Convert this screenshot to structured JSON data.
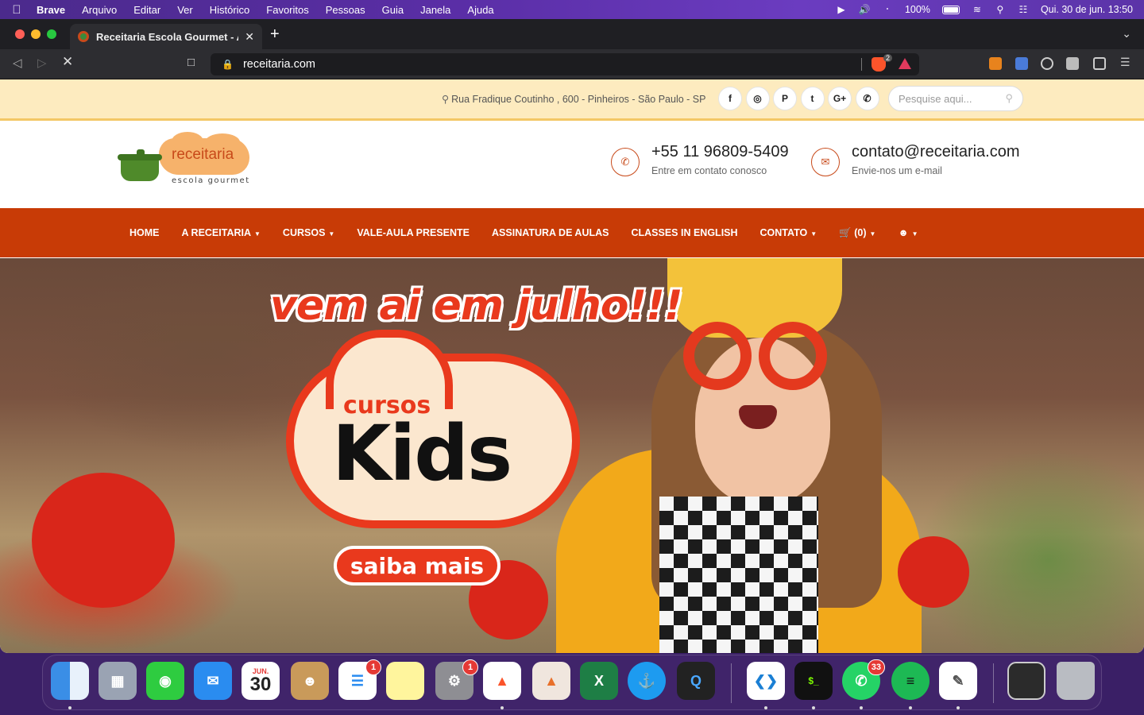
{
  "menubar": {
    "app": "Brave",
    "items": [
      "Arquivo",
      "Editar",
      "Ver",
      "Histórico",
      "Favoritos",
      "Pessoas",
      "Guia",
      "Janela",
      "Ajuda"
    ],
    "battery": "100%",
    "datetime": "Qui. 30 de jun.  13:50"
  },
  "browser": {
    "tab_title": "Receitaria Escola Gourmet - Aq",
    "url": "receitaria.com",
    "shields_count": "2"
  },
  "site": {
    "address": "Rua Fradique Coutinho , 600 - Pinheiros - São Paulo - SP",
    "social": [
      "f",
      "◎",
      "P",
      "t",
      "G+",
      "✆"
    ],
    "search_placeholder": "Pesquise aqui...",
    "logo_word": "receitaria",
    "logo_sub": "escola gourmet",
    "phone": "+55 11 96809-5409",
    "phone_sub": "Entre em contato conosco",
    "email": "contato@receitaria.com",
    "email_sub": "Envie-nos um e-mail",
    "nav": [
      {
        "label": "HOME",
        "caret": false
      },
      {
        "label": "A RECEITARIA",
        "caret": true
      },
      {
        "label": "CURSOS",
        "caret": true
      },
      {
        "label": "VALE-AULA PRESENTE",
        "caret": false
      },
      {
        "label": "ASSINATURA DE AULAS",
        "caret": false
      },
      {
        "label": "CLASSES IN ENGLISH",
        "caret": false
      },
      {
        "label": "CONTATO",
        "caret": true
      }
    ],
    "cart": "(0)",
    "hero": {
      "headline": "vem ai em julho!!!",
      "cursos": "cursos",
      "kids": "Kids",
      "cta": "saiba mais"
    }
  },
  "dock": {
    "calendar_month": "JUN.",
    "calendar_day": "30",
    "reminders_badge": "1",
    "settings_badge": "1",
    "whatsapp_badge": "33"
  },
  "colors": {
    "brand_orange": "#c83b06",
    "accent_red": "#e9391d",
    "topstrip": "#fdebbf"
  }
}
